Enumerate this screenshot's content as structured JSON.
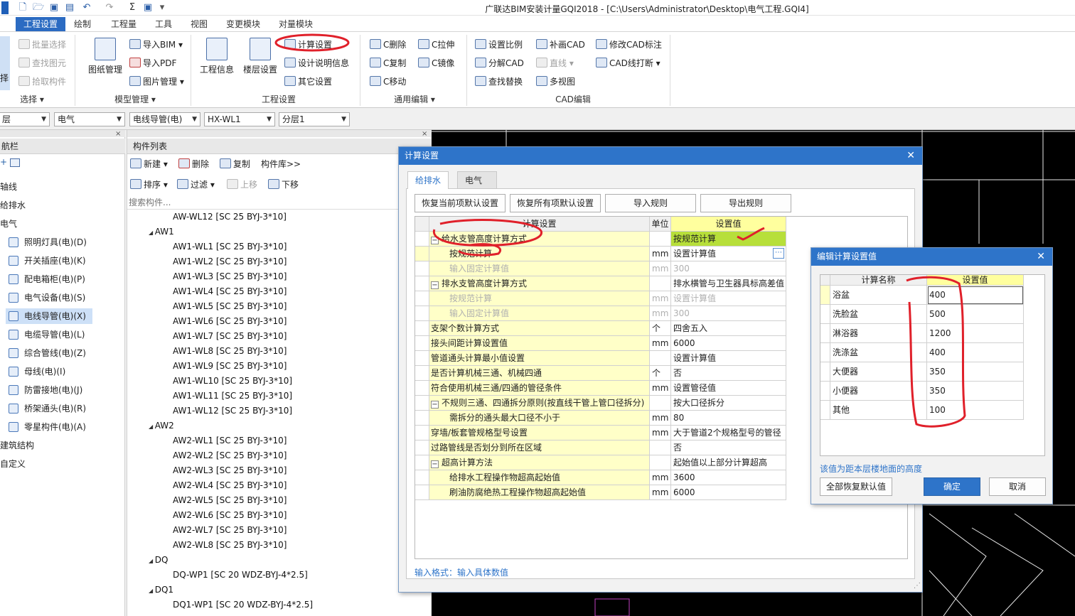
{
  "window": {
    "title": "广联达BIM安装计量GQI2018 - [C:\\Users\\Administrator\\Desktop\\电气工程.GQI4]"
  },
  "menu": {
    "tabs": [
      "工程设置",
      "绘制",
      "工程量",
      "工具",
      "视图",
      "变更模块",
      "对量模块"
    ]
  },
  "ribbon": {
    "select_group": {
      "label": "选择",
      "items": [
        "批量选择",
        "查找图元",
        "拾取构件"
      ],
      "partial_big": "择"
    },
    "model_group": {
      "label": "模型管理",
      "big": "图纸管理",
      "items": [
        "导入BIM",
        "导入PDF",
        "图片管理"
      ]
    },
    "project_group": {
      "label": "工程设置",
      "big1": "工程信息",
      "big2": "楼层设置",
      "items": [
        "计算设置",
        "设计说明信息",
        "其它设置"
      ]
    },
    "edit_group": {
      "label": "通用编辑",
      "items": [
        "C删除",
        "C复制",
        "C移动",
        "C拉伸",
        "C镜像"
      ]
    },
    "cad_group": {
      "label": "CAD编辑",
      "items": [
        "设置比例",
        "分解CAD",
        "查找替换",
        "补画CAD",
        "直线",
        "多视图",
        "修改CAD标注",
        "CAD线打断"
      ]
    }
  },
  "combos": {
    "c0": "层",
    "c1": "电气",
    "c2": "电线导管(电)",
    "c3": "HX-WL1",
    "c4": "分层1"
  },
  "leftnav": {
    "title": "航栏",
    "items": [
      "轴线",
      "给排水",
      "电气",
      "照明灯具(电)(D)",
      "开关插座(电)(K)",
      "配电箱柜(电)(P)",
      "电气设备(电)(S)",
      "电线导管(电)(X)",
      "电缆导管(电)(L)",
      "综合管线(电)(Z)",
      "母线(电)(I)",
      "防雷接地(电)(J)",
      "桥架通头(电)(R)",
      "零星构件(电)(A)",
      "建筑结构",
      "自定义"
    ]
  },
  "complist": {
    "title": "构件列表",
    "toolbar": [
      "新建",
      "删除",
      "复制",
      "构件库>>",
      "排序",
      "过滤",
      "上移",
      "下移"
    ],
    "search_placeholder": "搜索构件...",
    "rows": [
      "AW-WL12 [SC 25 BYJ-3*10]",
      "AW1",
      "AW1-WL1 [SC 25 BYJ-3*10]",
      "AW1-WL2 [SC 25 BYJ-3*10]",
      "AW1-WL3 [SC 25 BYJ-3*10]",
      "AW1-WL4 [SC 25 BYJ-3*10]",
      "AW1-WL5 [SC 25 BYJ-3*10]",
      "AW1-WL6 [SC 25 BYJ-3*10]",
      "AW1-WL7 [SC 25 BYJ-3*10]",
      "AW1-WL8 [SC 25 BYJ-3*10]",
      "AW1-WL9 [SC 25 BYJ-3*10]",
      "AW1-WL10 [SC 25 BYJ-3*10]",
      "AW1-WL11 [SC 25 BYJ-3*10]",
      "AW1-WL12 [SC 25 BYJ-3*10]",
      "AW2",
      "AW2-WL1 [SC 25 BYJ-3*10]",
      "AW2-WL2 [SC 25 BYJ-3*10]",
      "AW2-WL3 [SC 25 BYJ-3*10]",
      "AW2-WL4 [SC 25 BYJ-3*10]",
      "AW2-WL5 [SC 25 BYJ-3*10]",
      "AW2-WL6 [SC 25 BYJ-3*10]",
      "AW2-WL7 [SC 25 BYJ-3*10]",
      "AW2-WL8 [SC 25 BYJ-3*10]",
      "DQ",
      "DQ-WP1 [SC 20 WDZ-BYJ-4*2.5]",
      "DQ1",
      "DQ1-WP1 [SC 20 WDZ-BYJ-4*2.5]"
    ]
  },
  "calc_dialog": {
    "title": "计算设置",
    "tabs": [
      "给排水",
      "电气"
    ],
    "buttons": [
      "恢复当前项默认设置",
      "恢复所有项默认设置",
      "导入规则",
      "导出规则"
    ],
    "headers": [
      "计算设置",
      "单位",
      "设置值"
    ],
    "rows": [
      {
        "name": "给水支管高度计算方式",
        "unit": "",
        "value": "按规范计算"
      },
      {
        "name": "按规范计算",
        "unit": "mm",
        "value": "设置计算值"
      },
      {
        "name": "输入固定计算值",
        "unit": "mm",
        "value": "300"
      },
      {
        "name": "排水支管高度计算方式",
        "unit": "",
        "value": "排水横管与卫生器具标高差值"
      },
      {
        "name": "按规范计算",
        "unit": "mm",
        "value": "设置计算值"
      },
      {
        "name": "输入固定计算值",
        "unit": "mm",
        "value": "300"
      },
      {
        "name": "支架个数计算方式",
        "unit": "个",
        "value": "四舍五入"
      },
      {
        "name": "接头间距计算设置值",
        "unit": "mm",
        "value": "6000"
      },
      {
        "name": "管道通头计算最小值设置",
        "unit": "",
        "value": "设置计算值"
      },
      {
        "name": "是否计算机械三通、机械四通",
        "unit": "个",
        "value": "否"
      },
      {
        "name": "符合使用机械三通/四通的管径条件",
        "unit": "mm",
        "value": "设置管径值"
      },
      {
        "name": "不规则三通、四通拆分原则(按直线干管上管口径拆分)",
        "unit": "",
        "value": "按大口径拆分"
      },
      {
        "name": "需拆分的通头最大口径不小于",
        "unit": "mm",
        "value": "80"
      },
      {
        "name": "穿墙/板套管规格型号设置",
        "unit": "mm",
        "value": "大于管道2个规格型号的管径"
      },
      {
        "name": "过路管线是否划分到所在区域",
        "unit": "",
        "value": "否"
      },
      {
        "name": "超高计算方法",
        "unit": "",
        "value": "起始值以上部分计算超高"
      },
      {
        "name": "给排水工程操作物超高起始值",
        "unit": "mm",
        "value": "3600"
      },
      {
        "name": "刷油防腐绝热工程操作物超高起始值",
        "unit": "mm",
        "value": "6000"
      }
    ],
    "hint": "输入格式：输入具体数值"
  },
  "edit_dialog": {
    "title": "编辑计算设置值",
    "headers": [
      "计算名称",
      "设置值"
    ],
    "rows": [
      {
        "name": "浴盆",
        "value": "400"
      },
      {
        "name": "洗脸盆",
        "value": "500"
      },
      {
        "name": "淋浴器",
        "value": "1200"
      },
      {
        "name": "洗涤盆",
        "value": "400"
      },
      {
        "name": "大便器",
        "value": "350"
      },
      {
        "name": "小便器",
        "value": "350"
      },
      {
        "name": "其他",
        "value": "100"
      }
    ],
    "note": "该值为距本层楼地面的高度",
    "buttons": {
      "reset": "全部恢复默认值",
      "ok": "确定",
      "cancel": "取消"
    }
  },
  "colors": {
    "accent": "#2e74c9",
    "annotation": "#e0202a",
    "highlight_cell": "#b7df3a",
    "yellow_row": "#ffffc8"
  }
}
